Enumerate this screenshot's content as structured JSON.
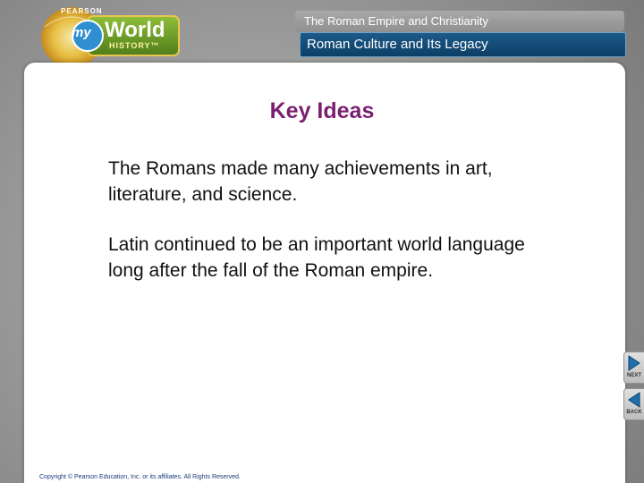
{
  "header": {
    "chapter_title": "The Roman Empire and Christianity",
    "section_title": "Roman Culture and Its Legacy"
  },
  "logo": {
    "publisher": "PEARSON",
    "my": "my",
    "world": "World",
    "history": "HISTORY™"
  },
  "slide": {
    "title": "Key Ideas",
    "paragraphs": [
      "The Romans made many achievements in art, literature, and science.",
      "Latin continued to be an important world language long after the fall of the Roman empire."
    ]
  },
  "footer": {
    "copyright": "Copyright © Pearson Education, Inc. or its affiliates. All Rights Reserved."
  },
  "nav": {
    "next_label": "NEXT",
    "back_label": "BACK"
  },
  "colors": {
    "title": "#7b1e70",
    "section_bar": "#0d3f66",
    "logo_green": "#6a9a2a",
    "logo_gold": "#d9a520"
  }
}
